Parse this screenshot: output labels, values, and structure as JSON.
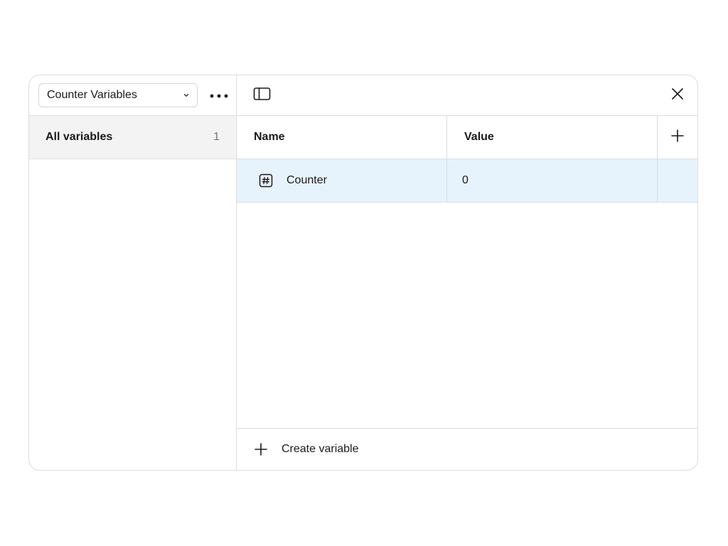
{
  "collection": {
    "selected": "Counter Variables",
    "dropdown_icon": "chevron-down-icon",
    "more_icon": "more-horizontal-icon"
  },
  "groups": [
    {
      "label": "All variables",
      "count": "1"
    }
  ],
  "header": {
    "sidebar_icon": "sidebar-toggle-icon",
    "close_icon": "close-icon"
  },
  "table": {
    "columns": [
      "Name",
      "Value"
    ],
    "add_column_icon": "plus-icon",
    "rows": [
      {
        "type_icon": "number-hash-icon",
        "name": "Counter",
        "value": "0"
      }
    ]
  },
  "footer": {
    "create_label": "Create variable",
    "create_icon": "plus-icon"
  },
  "colors": {
    "selected_row": "#e7f3fc",
    "sidebar_selected": "#f3f3f3",
    "border": "#dcdcdc"
  }
}
